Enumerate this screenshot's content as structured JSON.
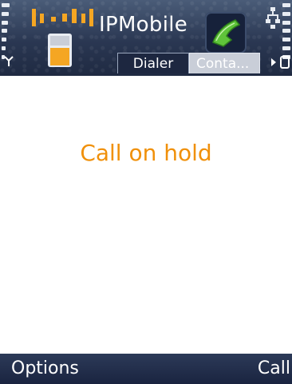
{
  "header": {
    "app_title": "IPMobile",
    "tabs": [
      {
        "label": "Dialer",
        "active": true
      },
      {
        "label": "Conta...",
        "active": false
      }
    ],
    "icons": {
      "app": "ipmobile-app-icon",
      "call": "green-phone-handset-icon",
      "network": "network-icon",
      "signal": "antenna-icon",
      "tab_next": "chevron-right-icon",
      "tab_more": "more-tabs-icon"
    }
  },
  "main": {
    "status_message": "Call on hold"
  },
  "softkeys": {
    "left": "Options",
    "right": "Call"
  },
  "colors": {
    "status_text": "#f0900a",
    "header_bg": "#2a3752",
    "softkey_bg": "#1f2a42",
    "app_icon_accent": "#f5a623"
  }
}
